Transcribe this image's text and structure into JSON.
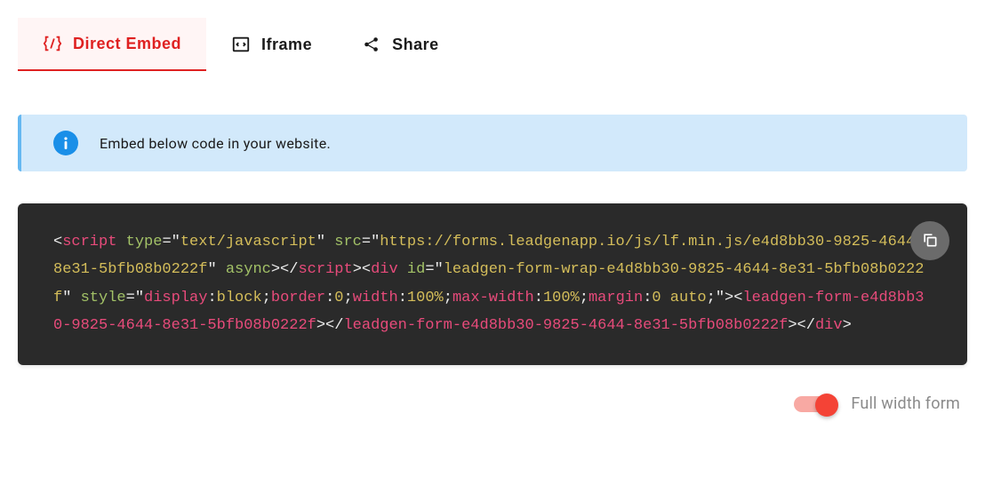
{
  "tabs": {
    "direct_embed": "Direct Embed",
    "iframe": "Iframe",
    "share": "Share"
  },
  "banner": {
    "text": "Embed below code in your website."
  },
  "code": {
    "src": "https://forms.leadgenapp.io/js/lf.min.js/e4d8bb30-9825-4644-8e31-5bfb08b0222f",
    "type_attr": "text/javascript",
    "div_id": "leadgen-form-wrap-e4d8bb30-9825-4644-8e31-5bfb08b0222f",
    "style_display": "block",
    "style_border": "0",
    "style_width": "100%",
    "style_max_width": "100%",
    "style_margin": "0 auto",
    "custom_tag": "leadgen-form-e4d8bb30-9825-4644-8e31-5bfb08b0222f"
  },
  "toggle": {
    "full_width_label": "Full width form"
  }
}
